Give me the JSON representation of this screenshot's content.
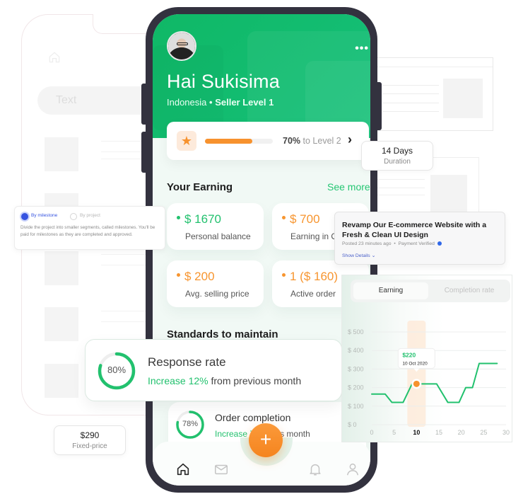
{
  "profile": {
    "greeting": "Hai Sukisima",
    "country": "Indonesia",
    "separator": "•",
    "seller_level": "Seller Level 1",
    "menu_icon": "more-horizontal-icon"
  },
  "level": {
    "progress_percent": 70,
    "progress_label": "70%",
    "target_label": "to Level 2",
    "icon": "star-icon"
  },
  "earning": {
    "title": "Your Earning",
    "see_more": "See more",
    "cards": [
      {
        "value": "$ 1670",
        "label": "Personal balance",
        "accent": "green"
      },
      {
        "value": "$ 700",
        "label": "Earning in O",
        "accent": "orange"
      },
      {
        "value": "$ 200",
        "label": "Avg. selling price",
        "accent": "orange"
      },
      {
        "value": "1 ($ 160)",
        "label": "Active order",
        "accent": "orange"
      }
    ]
  },
  "standards": {
    "title": "Standards to maintain",
    "response": {
      "title": "Response rate",
      "percent": 80,
      "percent_label": "80%",
      "highlight": "Increase 12%",
      "rest": "from previous month"
    },
    "order": {
      "title": "Order completion",
      "percent": 78,
      "percent_label": "78%",
      "highlight": "Increase 7",
      "rest": "revious month"
    }
  },
  "nav": {
    "items": [
      "home-icon",
      "mail-icon",
      "bell-icon",
      "user-icon"
    ],
    "fab_label": "+"
  },
  "wireframe": {
    "search_placeholder": "Text"
  },
  "milestone": {
    "option_selected": "By milestone",
    "option_other": "By project",
    "description": "Divide the project into smaller segments, called milestones. You'll be paid for milestones as they are completed and approved."
  },
  "duration": {
    "value": "14 Days",
    "label": "Duration"
  },
  "fixed_price": {
    "value": "$290",
    "label": "Fixed-price"
  },
  "job": {
    "title": "Revamp Our E-commerce Website with a Fresh & Clean UI Design",
    "posted": "Posted 23 minutes ago",
    "bullet": "•",
    "payment": "Payment Verified",
    "show_details": "Show Details",
    "chevron": "⌄"
  },
  "chart_tabs": {
    "active": "Earning",
    "inactive": "Completion rate"
  },
  "colors": {
    "brand_green": "#22c16e",
    "accent_orange": "#f7922e",
    "phone_frame": "#33323f"
  },
  "chart_data": {
    "type": "line",
    "title": "",
    "xlabel": "",
    "ylabel": "",
    "x_ticks": [
      0,
      5,
      10,
      15,
      20,
      25,
      30
    ],
    "y_ticks": [
      0,
      100,
      200,
      300,
      400,
      500
    ],
    "y_tick_labels": [
      "$ 0",
      "$ 100",
      "$ 200",
      "$ 300",
      "$ 400",
      "$ 500"
    ],
    "xlim": [
      0,
      30
    ],
    "ylim": [
      0,
      500
    ],
    "grid": true,
    "highlight_x_tick": 10,
    "series": [
      {
        "name": "Earning",
        "x": [
          0,
          3,
          4.5,
          7,
          9,
          10,
          11.5,
          14.5,
          17,
          19.5,
          21,
          22.5,
          24,
          25,
          28
        ],
        "values": [
          165,
          165,
          120,
          120,
          220,
          220,
          220,
          220,
          120,
          120,
          200,
          200,
          330,
          330,
          330
        ]
      }
    ],
    "highlighted_point": {
      "x": 10,
      "y": 220,
      "label": "$220",
      "date": "10 Oct 2020"
    }
  }
}
